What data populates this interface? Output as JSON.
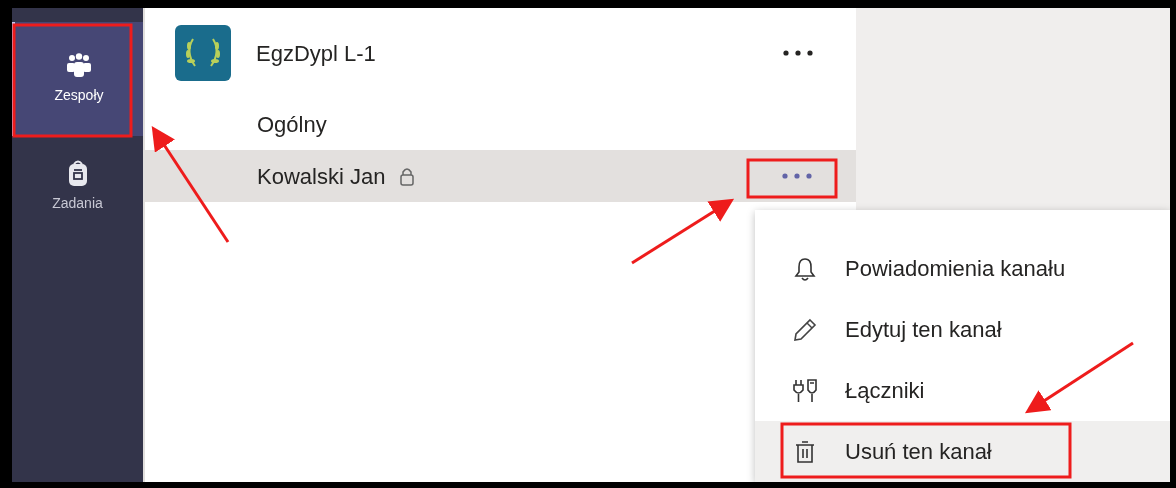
{
  "rail": [
    {
      "label": "Zespoły",
      "kind": "people",
      "selected": true
    },
    {
      "label": "Zadania",
      "kind": "bag",
      "selected": false
    }
  ],
  "team": {
    "name": "EgzDypl L-1"
  },
  "channels": [
    {
      "name": "Ogólny",
      "locked": false,
      "selected": false
    },
    {
      "name": "Kowalski Jan",
      "locked": true,
      "selected": true
    }
  ],
  "context_menu": {
    "items": [
      {
        "label": "Powiadomienia kanału",
        "kind": "bell",
        "highlighted": false
      },
      {
        "label": "Edytuj ten kanał",
        "kind": "pencil",
        "highlighted": false
      },
      {
        "label": "Łączniki",
        "kind": "plugs",
        "highlighted": false
      },
      {
        "label": "Usuń ten kanał",
        "kind": "trash",
        "highlighted": true
      }
    ]
  }
}
